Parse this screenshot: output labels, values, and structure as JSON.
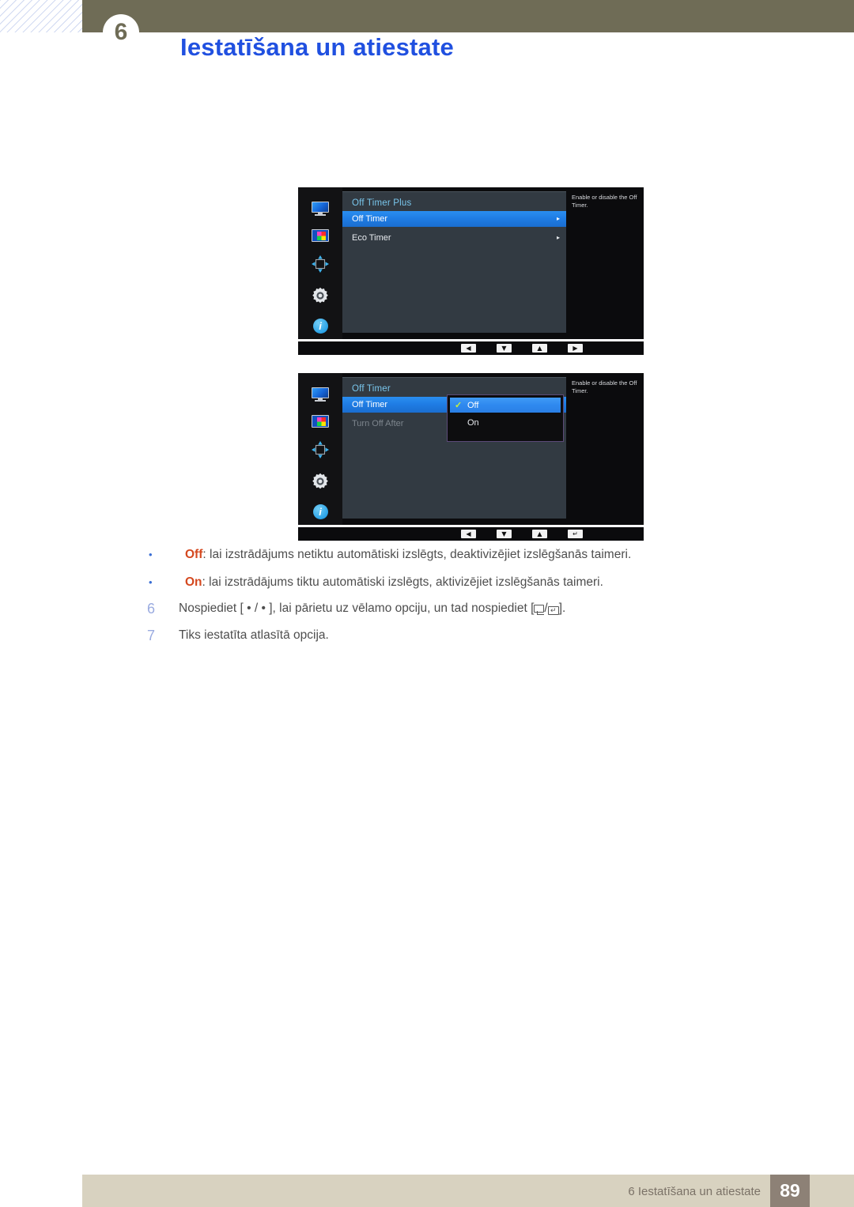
{
  "header": {
    "chapter_number": "6",
    "title": "Iestatīšana un atiestate"
  },
  "osd_screens": [
    {
      "name": "off-timer-plus",
      "title": "Off Timer Plus",
      "help_text": "Enable or disable the Off Timer.",
      "rows": [
        {
          "label": "Off Timer",
          "selected": true,
          "arrow": "▸",
          "dim": false
        },
        {
          "label": "Eco Timer",
          "selected": false,
          "arrow": "▸",
          "dim": false
        }
      ],
      "sidebar_icons": [
        "monitor-icon",
        "picture-color-icon",
        "size-position-icon",
        "settings-gear-icon",
        "information-icon"
      ],
      "navkeys": [
        {
          "name": "nav-left-key",
          "glyph": "◀"
        },
        {
          "name": "nav-down-key",
          "glyph": "▼"
        },
        {
          "name": "nav-up-key",
          "glyph": "▲"
        },
        {
          "name": "nav-right-key",
          "glyph": "▶"
        }
      ]
    },
    {
      "name": "off-timer",
      "title": "Off Timer",
      "help_text": "Enable or disable the Off Timer.",
      "rows": [
        {
          "label": "Off Timer",
          "selected": true,
          "arrow": "",
          "dim": false
        },
        {
          "label": "Turn Off After",
          "selected": false,
          "arrow": "",
          "dim": true
        }
      ],
      "popup": {
        "options": [
          {
            "label": "Off",
            "selected": true,
            "checked": true
          },
          {
            "label": "On",
            "selected": false,
            "checked": false
          }
        ]
      },
      "sidebar_icons": [
        "monitor-icon",
        "picture-color-icon",
        "size-position-icon",
        "settings-gear-icon",
        "information-icon"
      ],
      "navkeys": [
        {
          "name": "nav-left-key",
          "glyph": "◀"
        },
        {
          "name": "nav-down-key",
          "glyph": "▼"
        },
        {
          "name": "nav-up-key",
          "glyph": "▲"
        },
        {
          "name": "nav-enter-key",
          "glyph": "↵"
        }
      ]
    }
  ],
  "bullets": [
    {
      "marker": "•",
      "keyword": "Off",
      "text": ": lai izstrādājums netiktu automātiski izslēgts, deaktivizējiet izslēgšanās taimeri."
    },
    {
      "marker": "•",
      "keyword": "On",
      "text": ": lai izstrādājums tiktu automātiski izslēgts, aktivizējiet izslēgšanās taimeri."
    }
  ],
  "steps": [
    {
      "number": "6",
      "text_before": "Nospiediet [ • / • ], lai pārietu uz vēlamo opciju, un tad nospiediet [",
      "glyph_separator": "/",
      "text_after": "]."
    },
    {
      "number": "7",
      "text_before": "Tiks iestatīta atlasītā opcija.",
      "glyph_separator": "",
      "text_after": ""
    }
  ],
  "footer": {
    "text": "6 Iestatīšana un atiestate",
    "page_number": "89"
  },
  "colors": {
    "header_olive": "#6f6c56",
    "title_blue": "#2050e0",
    "keyword_orange": "#d4481f",
    "step_number_blue": "#9aabe0",
    "footer_bar": "#d8d2c0",
    "page_box": "#8d8176",
    "osd_highlight": "#2a8ef0",
    "osd_check_green": "#c8f03c"
  }
}
